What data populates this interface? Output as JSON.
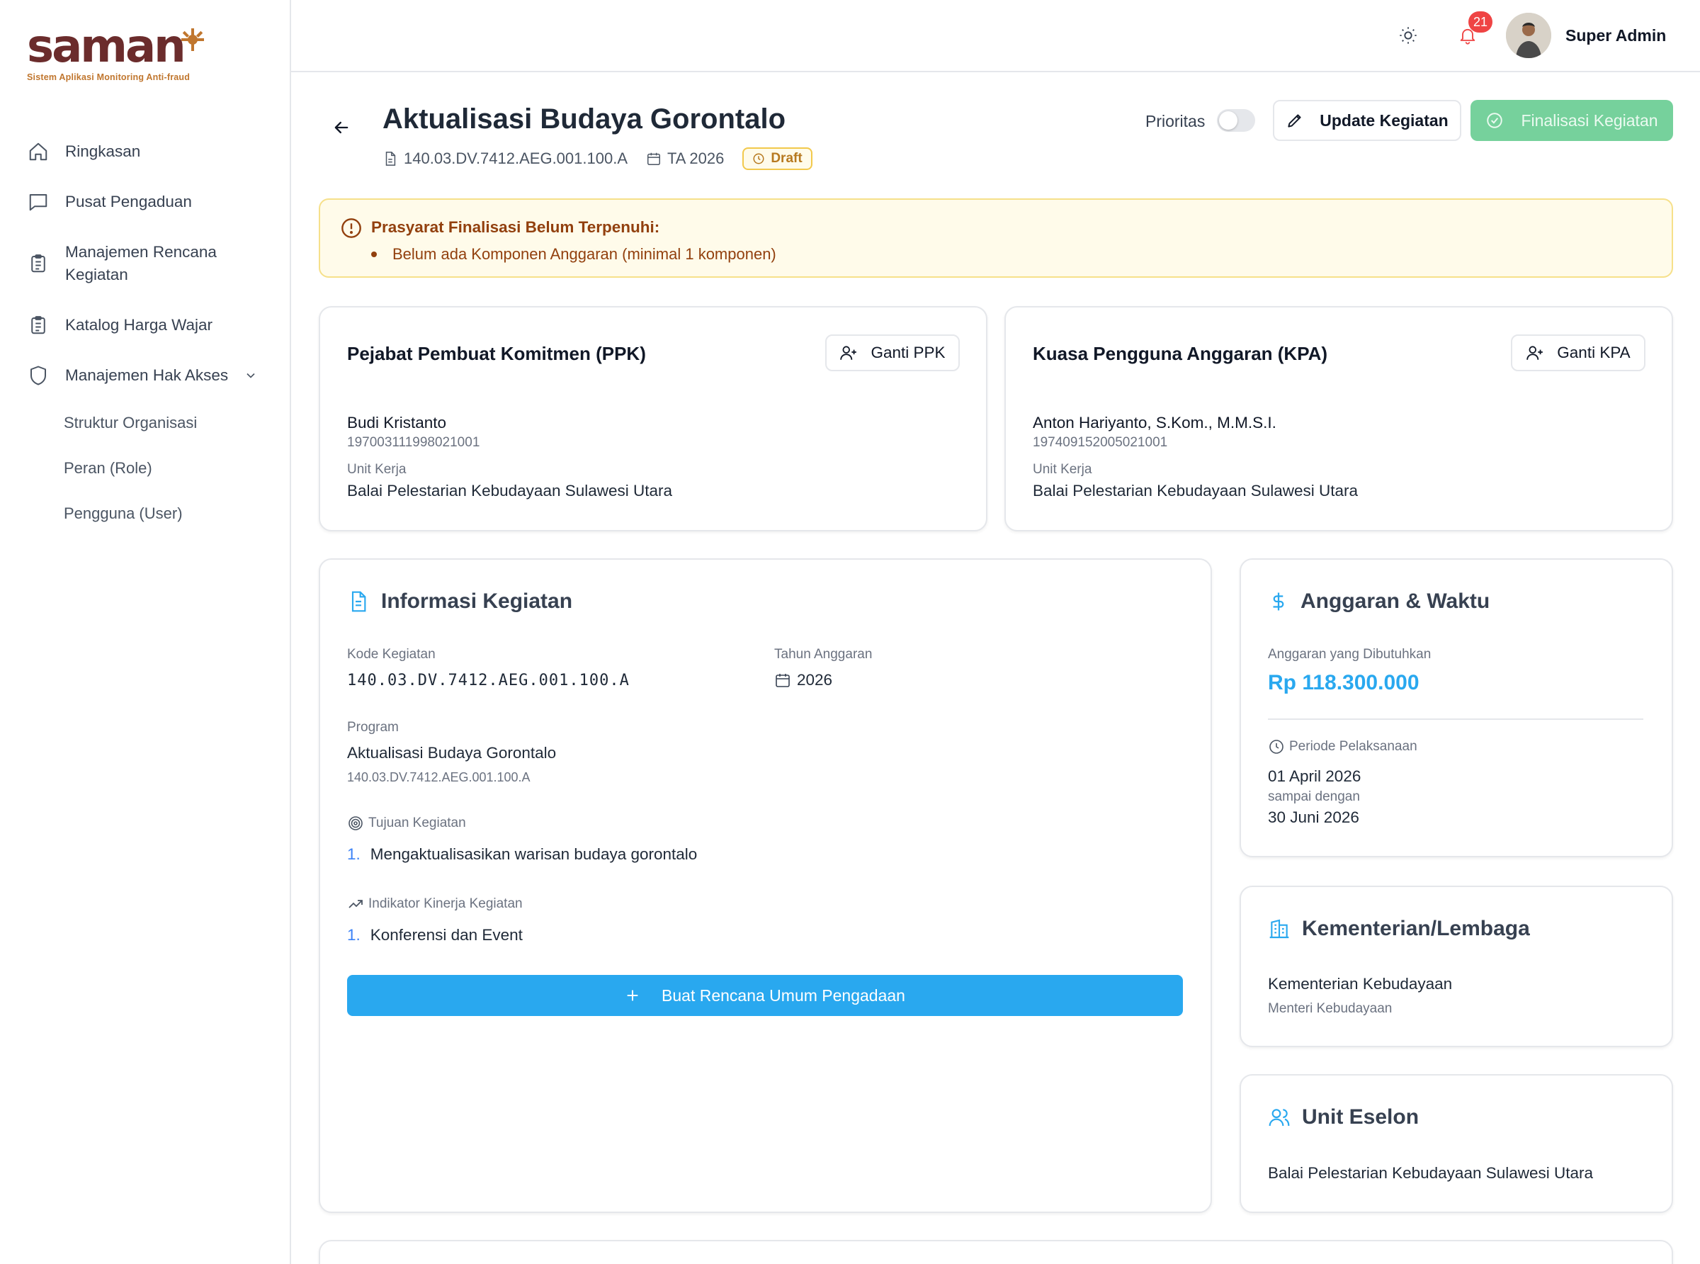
{
  "brand": {
    "name": "saman",
    "tagline": "Sistem Aplikasi Monitoring Anti-fraud",
    "colors": {
      "primary": "#6b2c2c",
      "accent": "#c0762e",
      "blue": "#29a8ef",
      "green": "#6fcf97",
      "warning": "#92400e"
    }
  },
  "sidebar": {
    "items": [
      {
        "label": "Ringkasan",
        "icon": "home-icon"
      },
      {
        "label": "Pusat Pengaduan",
        "icon": "message-icon"
      },
      {
        "label_line1": "Manajemen Rencana",
        "label_line2": "Kegiatan",
        "icon": "clipboard-icon"
      },
      {
        "label": "Katalog Harga Wajar",
        "icon": "clipboard-icon"
      },
      {
        "label": "Manajemen Hak Akses",
        "icon": "shield-icon",
        "expanded": true
      }
    ],
    "subitems": [
      {
        "label": "Struktur Organisasi"
      },
      {
        "label": "Peran (Role)"
      },
      {
        "label": "Pengguna (User)"
      }
    ]
  },
  "header": {
    "notification_count": "21",
    "user_name": "Super Admin"
  },
  "page": {
    "title": "Aktualisasi Budaya Gorontalo",
    "code": "140.03.DV.7412.AEG.001.100.A",
    "year": "TA 2026",
    "status": "Draft",
    "priority_label": "Prioritas",
    "priority_on": false,
    "update_button": "Update Kegiatan",
    "finalize_button": "Finalisasi Kegiatan"
  },
  "alert": {
    "title": "Prasyarat Finalisasi Belum Terpenuhi:",
    "items": [
      "Belum ada Komponen Anggaran (minimal 1 komponen)"
    ]
  },
  "ppk": {
    "title": "Pejabat Pembuat Komitmen (PPK)",
    "button": "Ganti PPK",
    "name": "Budi Kristanto",
    "nip": "197003111998021001",
    "unit_label": "Unit Kerja",
    "unit": "Balai Pelestarian Kebudayaan Sulawesi Utara"
  },
  "kpa": {
    "title": "Kuasa Pengguna Anggaran (KPA)",
    "button": "Ganti KPA",
    "name": "Anton Hariyanto, S.Kom., M.M.S.I.",
    "nip": "197409152005021001",
    "unit_label": "Unit Kerja",
    "unit": "Balai Pelestarian Kebudayaan Sulawesi Utara"
  },
  "info": {
    "title": "Informasi Kegiatan",
    "code_label": "Kode Kegiatan",
    "code": "140.03.DV.7412.AEG.001.100.A",
    "year_label": "Tahun Anggaran",
    "year": "2026",
    "program_label": "Program",
    "program_name": "Aktualisasi Budaya Gorontalo",
    "program_code": "140.03.DV.7412.AEG.001.100.A",
    "goal_label": "Tujuan Kegiatan",
    "goals": [
      {
        "num": "1.",
        "text": "Mengaktualisasikan warisan budaya gorontalo"
      }
    ],
    "indicator_label": "Indikator Kinerja Kegiatan",
    "indicators": [
      {
        "num": "1.",
        "text": "Konferensi dan Event"
      }
    ],
    "create_button": "Buat Rencana Umum Pengadaan"
  },
  "budget": {
    "title": "Anggaran & Waktu",
    "amount_label": "Anggaran yang Dibutuhkan",
    "amount": "Rp 118.300.000",
    "period_label": "Periode Pelaksanaan",
    "start": "01 April 2026",
    "until": "sampai dengan",
    "end": "30 Juni 2026"
  },
  "ministry": {
    "title": "Kementerian/Lembaga",
    "name": "Kementerian Kebudayaan",
    "head": "Menteri Kebudayaan"
  },
  "eselon": {
    "title": "Unit Eselon",
    "name": "Balai Pelestarian Kebudayaan Sulawesi Utara"
  }
}
